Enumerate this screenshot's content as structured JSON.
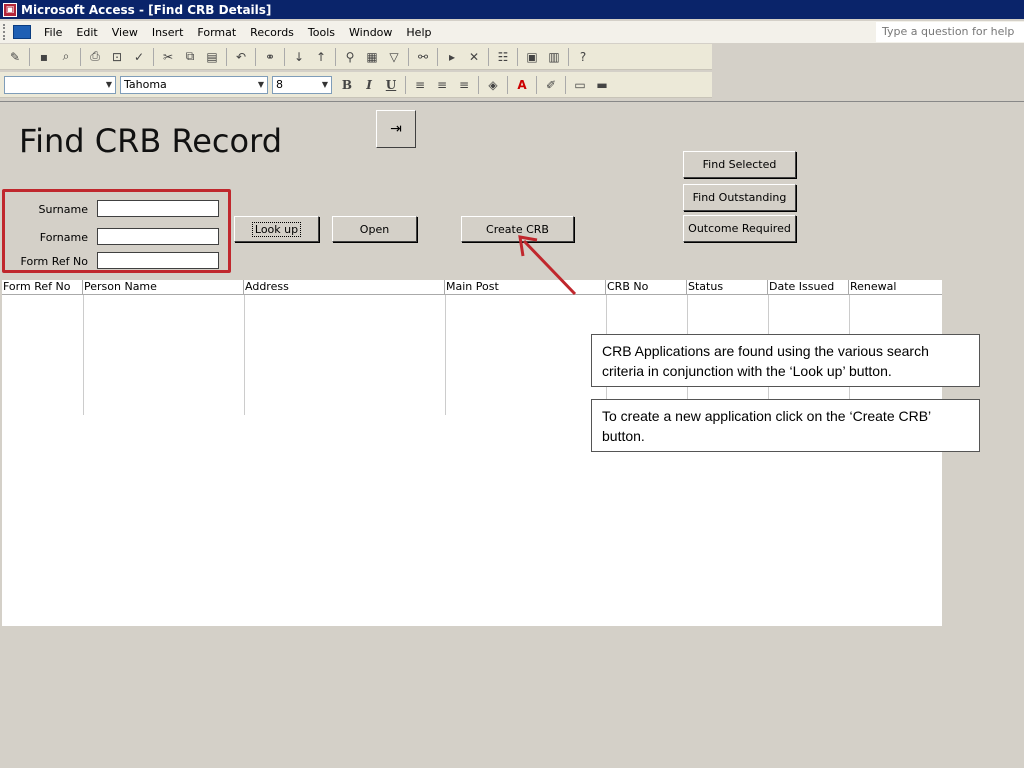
{
  "window": {
    "title": "Microsoft Access - [Find CRB Details]"
  },
  "menu": [
    "File",
    "Edit",
    "View",
    "Insert",
    "Format",
    "Records",
    "Tools",
    "Window",
    "Help"
  ],
  "help_placeholder": "Type a question for help",
  "format_toolbar": {
    "font": "Tahoma",
    "size": "8"
  },
  "form": {
    "title": "Find CRB Record",
    "surname_label": "Surname",
    "forname_label": "Forname",
    "formref_label": "Form Ref No",
    "lookup_label": "Look up",
    "open_label": "Open",
    "create_label": "Create CRB",
    "find_selected_label": "Find Selected",
    "find_outstanding_label": "Find Outstanding",
    "outcome_required_label": "Outcome Required"
  },
  "grid": {
    "columns": [
      "Form Ref No",
      "Person Name",
      "Address",
      "Main Post",
      "CRB No",
      "Status",
      "Date Issued",
      "Renewal"
    ]
  },
  "callouts": {
    "search": "CRB Applications are found using the various search criteria in conjunction with the ‘Look up’ button.",
    "create": "To create a new application click on the ‘Create CRB’ button."
  },
  "colors": {
    "highlight": "#c0272d",
    "titlebar": "#0a246a"
  }
}
